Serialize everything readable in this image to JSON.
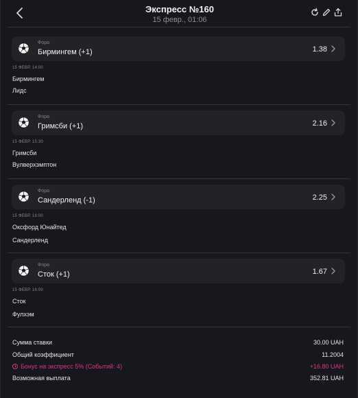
{
  "header": {
    "title": "Экспресс №160",
    "subtitle": "15 февр., 01:06"
  },
  "bets": [
    {
      "market": "Фора",
      "pick": "Бирмингем (+1)",
      "odds": "1.38",
      "date": "15 ФЕВР, 14:00",
      "team1": "Бирмингем",
      "team2": "Лидс"
    },
    {
      "market": "Фора",
      "pick": "Гримсби (+1)",
      "odds": "2.16",
      "date": "15 ФЕВР, 15:30",
      "team1": "Гримсби",
      "team2": "Вулверхэмптон"
    },
    {
      "market": "Фора",
      "pick": "Сандерленд (-1)",
      "odds": "2.25",
      "date": "15 ФЕВР, 16:00",
      "team1": "Оксфорд Юнайтед",
      "team2": "Сандерленд"
    },
    {
      "market": "Фора",
      "pick": "Сток (+1)",
      "odds": "1.67",
      "date": "15 ФЕВР, 16:00",
      "team1": "Сток",
      "team2": "Фулхэм"
    }
  ],
  "summary": {
    "stake_label": "Сумма ставки",
    "stake_value": "30.00 UAH",
    "coef_label": "Общий коэффициент",
    "coef_value": "11.2004",
    "bonus_label": "Бонус на экспресс 5% (Событий: 4)",
    "bonus_value": "+16.80 UAH",
    "payout_label": "Возможная выплата",
    "payout_value": "352.81 UAH"
  },
  "colors": {
    "background": "#17181b",
    "card": "#222327",
    "bonus_accent": "#e0318a"
  },
  "icons": [
    "back-arrow-icon",
    "refresh-icon",
    "edit-icon",
    "share-icon",
    "soccer-ball-icon",
    "chevron-right-icon",
    "info-icon"
  ]
}
